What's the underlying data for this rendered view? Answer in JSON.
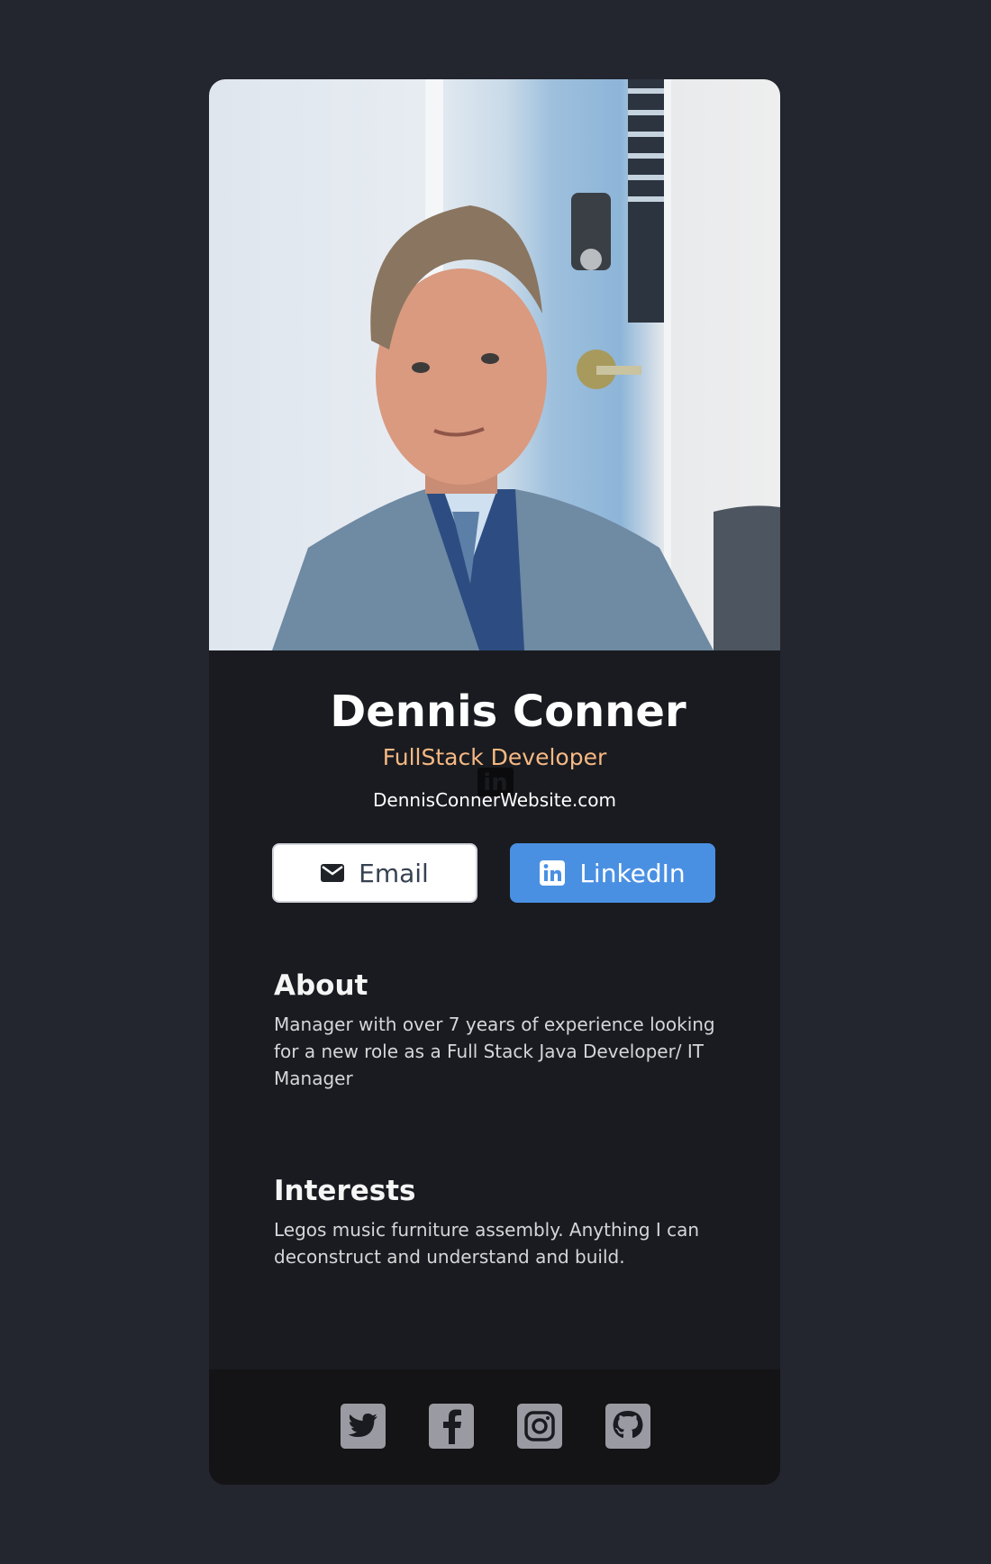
{
  "profile": {
    "photo_alt": "Portrait of Dennis Conner",
    "name": "Dennis Conner",
    "role": "FullStack Developer",
    "website": "DennisConnerWebsite.com"
  },
  "actions": {
    "email_label": "Email",
    "linkedin_label": "LinkedIn"
  },
  "about": {
    "title": "About",
    "text": "Manager with over 7 years of experience looking for a new role as a Full Stack Java Developer/ IT Manager"
  },
  "interests": {
    "title": "Interests",
    "text": "Legos music furniture assembly. Anything I can deconstruct and understand and build."
  },
  "footer": {
    "icons": [
      "twitter-icon",
      "facebook-icon",
      "instagram-icon",
      "github-icon"
    ]
  },
  "colors": {
    "page_bg": "#23252f",
    "card_bg": "#1a1b20",
    "footer_bg": "#141416",
    "role_accent": "#f6b984",
    "linkedin_blue": "#4a90e2",
    "social_icon_bg": "#9a9aa2"
  }
}
